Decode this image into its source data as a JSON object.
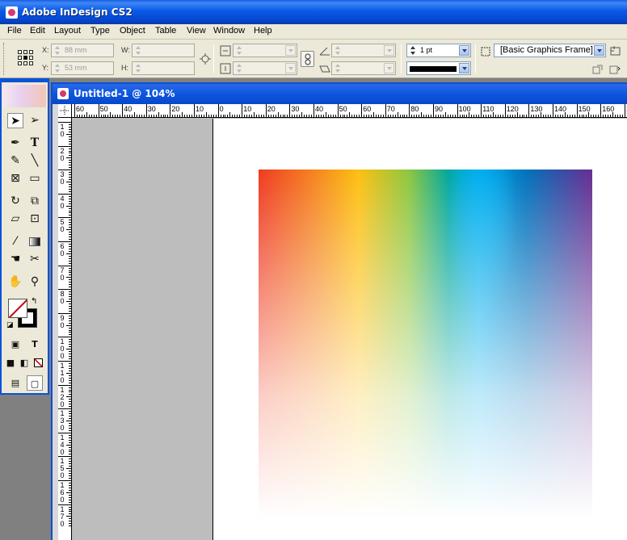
{
  "window": {
    "title": "Adobe InDesign CS2"
  },
  "menu": [
    "File",
    "Edit",
    "Layout",
    "Type",
    "Object",
    "Table",
    "View",
    "Window",
    "Help"
  ],
  "control": {
    "x_label": "X:",
    "x_value": "88 mm",
    "y_label": "Y:",
    "y_value": "53 mm",
    "w_label": "W:",
    "h_label": "H:",
    "stroke_weight": "1 pt",
    "object_style": "[Basic Graphics Frame]"
  },
  "document": {
    "title": "Untitled-1 @ 104%",
    "h_ruler": [
      "60",
      "50",
      "40",
      "30",
      "20",
      "10",
      "0",
      "10",
      "20",
      "30",
      "40",
      "50",
      "60",
      "70",
      "80",
      "90",
      "100",
      "110",
      "120",
      "130",
      "140",
      "150",
      "160",
      "170"
    ],
    "v_ruler": [
      "1\n0",
      "2\n0",
      "3\n0",
      "4\n0",
      "5\n0",
      "6\n0",
      "7\n0",
      "8\n0",
      "9\n0",
      "1\n0\n0",
      "1\n1\n0",
      "1\n2\n0",
      "1\n3\n0",
      "1\n4\n0",
      "1\n5\n0",
      "1\n6\n0",
      "1\n7\n0"
    ]
  },
  "tools": [
    "selection-tool",
    "direct-selection-tool",
    "pen-tool",
    "type-tool",
    "pencil-tool",
    "line-tool",
    "rectangle-frame-tool",
    "rectangle-tool",
    "rotate-tool",
    "scale-tool",
    "shear-tool",
    "free-transform-tool",
    "eyedropper-tool",
    "gradient-tool",
    "button-tool",
    "scissors-tool",
    "hand-tool",
    "zoom-tool"
  ],
  "colors": {
    "title_bar": "#0a5ae6",
    "menu_bg": "#ece9d8"
  }
}
